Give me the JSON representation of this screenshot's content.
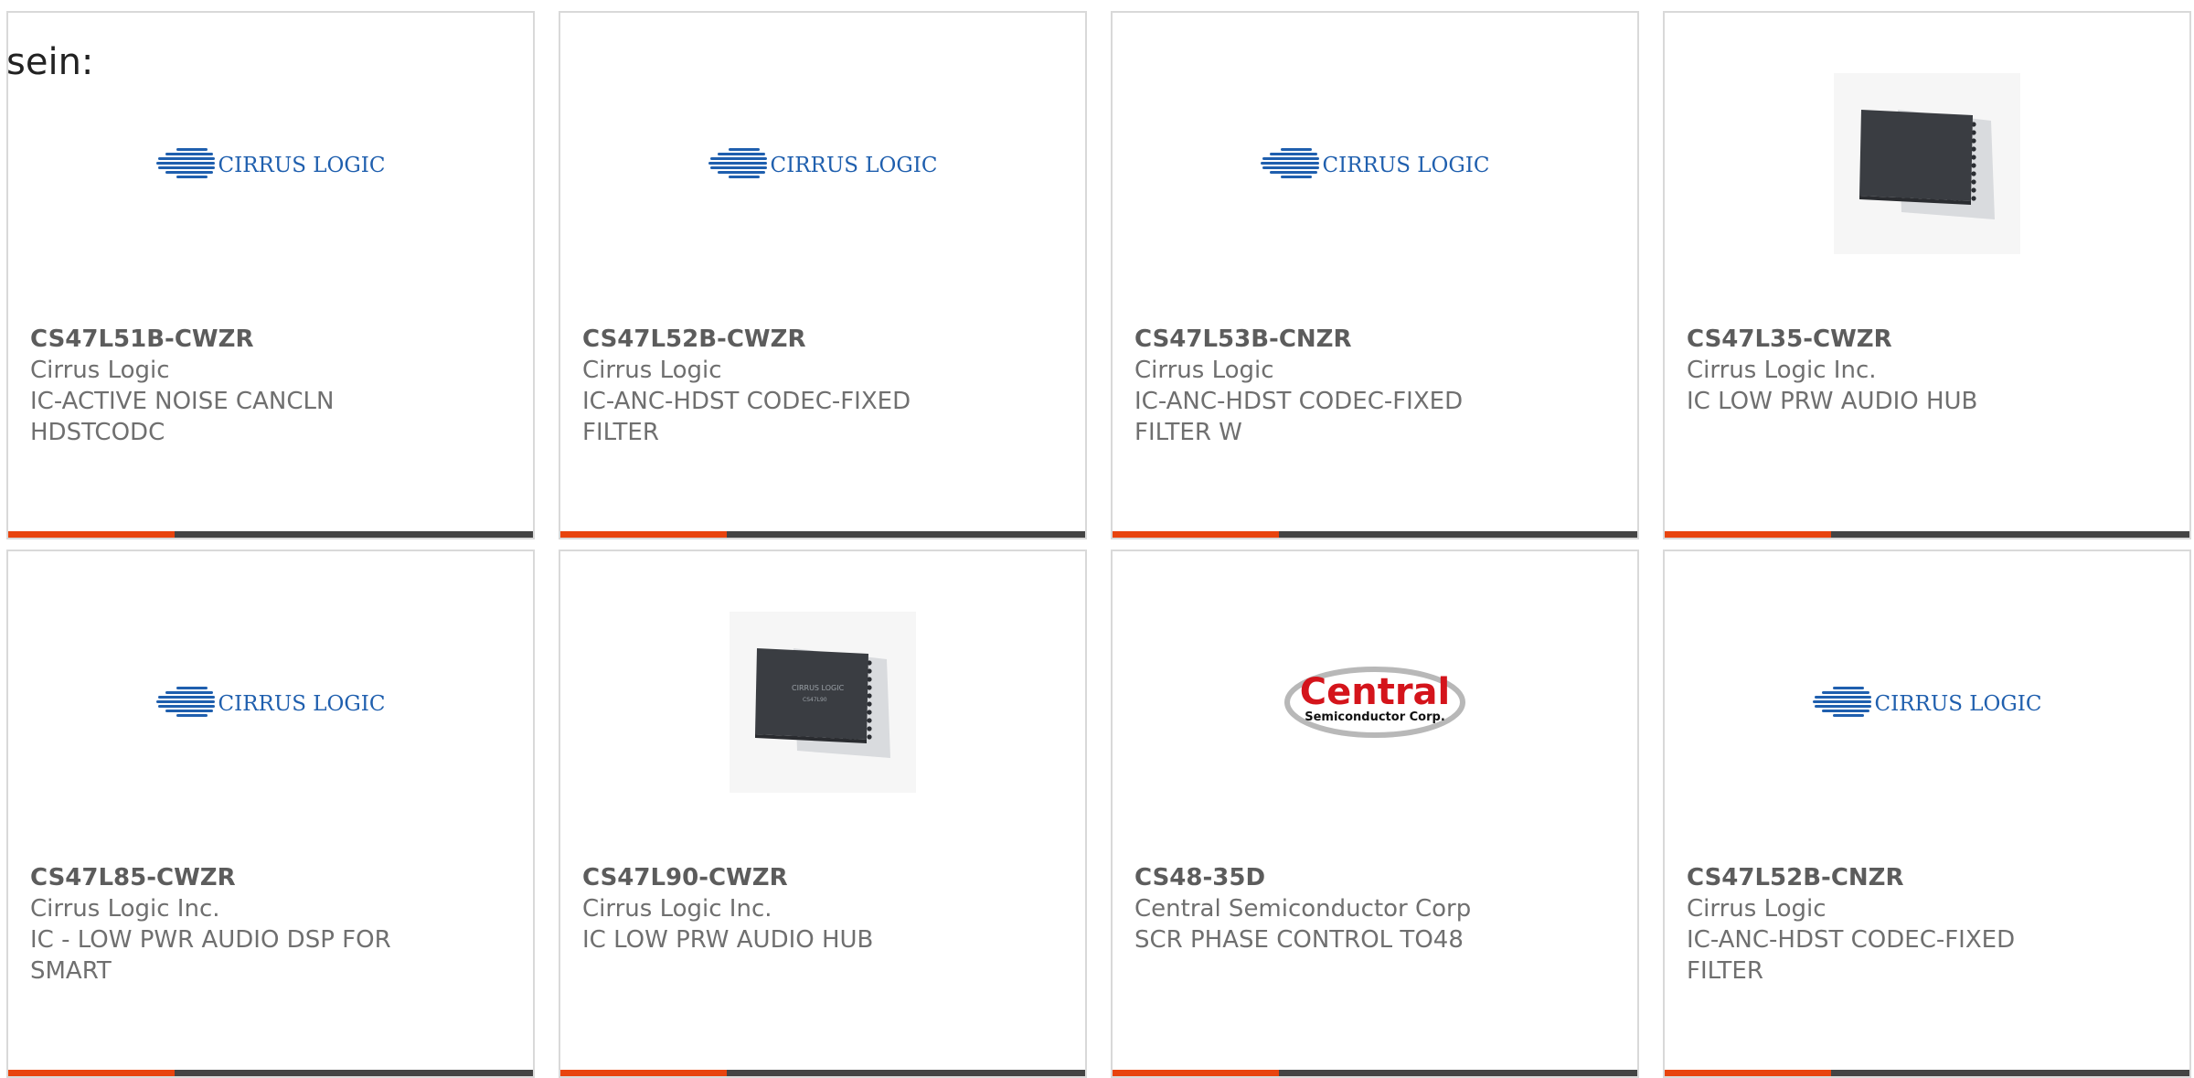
{
  "heading": "sein:",
  "products": [
    {
      "part": "CS47L51B-CWZR",
      "manufacturer": "Cirrus Logic",
      "description": "IC-ACTIVE NOISE CANCLN HDSTCODC",
      "image": "cirrus-logo"
    },
    {
      "part": "CS47L52B-CWZR",
      "manufacturer": "Cirrus Logic",
      "description": "IC-ANC-HDST CODEC-FIXED FILTER",
      "image": "cirrus-logo"
    },
    {
      "part": "CS47L53B-CNZR",
      "manufacturer": "Cirrus Logic",
      "description": "IC-ANC-HDST CODEC-FIXED FILTER W",
      "image": "cirrus-logo"
    },
    {
      "part": "CS47L35-CWZR",
      "manufacturer": "Cirrus Logic Inc.",
      "description": "IC LOW PRW AUDIO HUB",
      "image": "chip-photo"
    },
    {
      "part": "CS47L85-CWZR",
      "manufacturer": "Cirrus Logic Inc.",
      "description": "IC - LOW PWR AUDIO DSP FOR SMART",
      "image": "cirrus-logo"
    },
    {
      "part": "CS47L90-CWZR",
      "manufacturer": "Cirrus Logic Inc.",
      "description": "IC LOW PRW AUDIO HUB",
      "image": "chip-photo-labeled"
    },
    {
      "part": "CS48-35D",
      "manufacturer": "Central Semiconductor Corp",
      "description": "SCR PHASE CONTROL TO48",
      "image": "central-logo"
    },
    {
      "part": "CS47L52B-CNZR",
      "manufacturer": "Cirrus Logic",
      "description": "IC-ANC-HDST CODEC-FIXED FILTER",
      "image": "cirrus-logo"
    }
  ],
  "logos": {
    "cirrus_text": "CIRRUS LOGIC",
    "central_main": "Central",
    "central_sub": "Semiconductor Corp.",
    "chip_label_1": "CIRRUS LOGIC",
    "chip_label_2": "CS47L90"
  },
  "colors": {
    "accent": "#e8440e",
    "bar": "#444444",
    "cirrus_blue": "#1f5fae",
    "central_red": "#d4141b"
  }
}
